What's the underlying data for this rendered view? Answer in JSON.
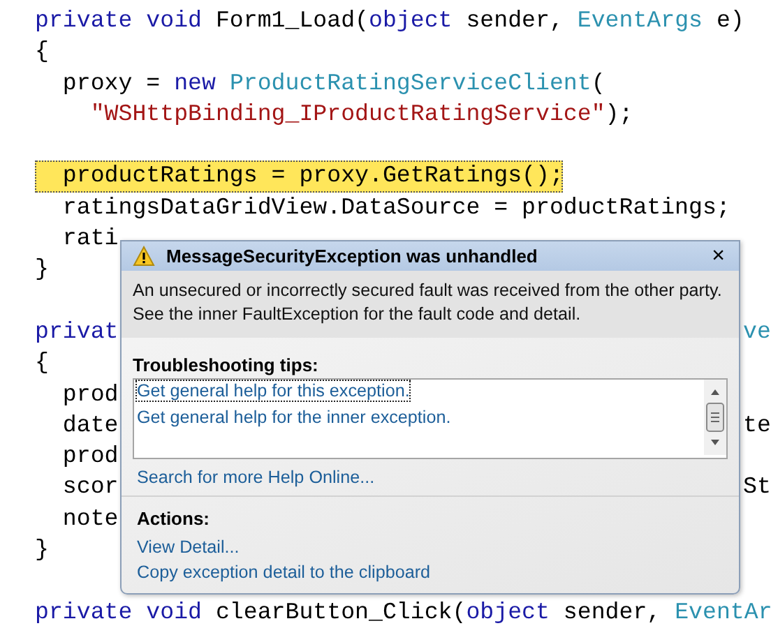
{
  "code_lines": [
    {
      "highlighted": false,
      "tokens": [
        {
          "kind": "kw",
          "text": "private void "
        },
        {
          "kind": "plain",
          "text": "Form1_Load("
        },
        {
          "kind": "kw",
          "text": "object"
        },
        {
          "kind": "plain",
          "text": " sender, "
        },
        {
          "kind": "type",
          "text": "EventArgs"
        },
        {
          "kind": "plain",
          "text": " e)"
        }
      ]
    },
    {
      "highlighted": false,
      "tokens": [
        {
          "kind": "plain",
          "text": "{"
        }
      ]
    },
    {
      "highlighted": false,
      "tokens": [
        {
          "kind": "plain",
          "text": "  proxy = "
        },
        {
          "kind": "kw",
          "text": "new "
        },
        {
          "kind": "type",
          "text": "ProductRatingServiceClient"
        },
        {
          "kind": "plain",
          "text": "("
        }
      ]
    },
    {
      "highlighted": false,
      "tokens": [
        {
          "kind": "str",
          "text": "    \"WSHttpBinding_IProductRatingService\""
        },
        {
          "kind": "plain",
          "text": ");"
        }
      ]
    },
    {
      "kind": "blank"
    },
    {
      "highlighted": true,
      "tokens": [
        {
          "kind": "plain",
          "text": "  productRatings = proxy.GetRatings();"
        }
      ]
    },
    {
      "highlighted": false,
      "tokens": [
        {
          "kind": "plain",
          "text": "  ratingsDataGridView.DataSource = productRatings;"
        }
      ]
    },
    {
      "highlighted": false,
      "tokens": [
        {
          "kind": "plain",
          "text": "  rati"
        }
      ]
    },
    {
      "highlighted": false,
      "tokens": [
        {
          "kind": "plain",
          "text": "}"
        }
      ]
    },
    {
      "kind": "blank"
    },
    {
      "highlighted": false,
      "tokens": [
        {
          "kind": "kw",
          "text": "privat"
        }
      ],
      "right": {
        "kind": "type",
        "text": "ve"
      }
    },
    {
      "highlighted": false,
      "tokens": [
        {
          "kind": "plain",
          "text": "{"
        }
      ]
    },
    {
      "highlighted": false,
      "tokens": [
        {
          "kind": "plain",
          "text": "  prod"
        }
      ]
    },
    {
      "highlighted": false,
      "tokens": [
        {
          "kind": "plain",
          "text": "  date"
        }
      ],
      "right": {
        "kind": "plain",
        "text": "te"
      }
    },
    {
      "highlighted": false,
      "tokens": [
        {
          "kind": "plain",
          "text": "  prod"
        }
      ]
    },
    {
      "highlighted": false,
      "tokens": [
        {
          "kind": "plain",
          "text": "  scor"
        }
      ],
      "right": {
        "kind": "plain",
        "text": "St"
      }
    },
    {
      "highlighted": false,
      "tokens": [
        {
          "kind": "plain",
          "text": "  note"
        }
      ]
    },
    {
      "highlighted": false,
      "tokens": [
        {
          "kind": "plain",
          "text": "}"
        }
      ]
    },
    {
      "kind": "blank"
    },
    {
      "highlighted": false,
      "tokens": [
        {
          "kind": "kw",
          "text": "private void "
        },
        {
          "kind": "plain",
          "text": "clearButton_Click("
        },
        {
          "kind": "kw",
          "text": "object"
        },
        {
          "kind": "plain",
          "text": " sender, "
        },
        {
          "kind": "type",
          "text": "EventAr"
        }
      ]
    }
  ],
  "exception_popup": {
    "title": "MessageSecurityException was unhandled",
    "close": "×",
    "message": "An unsecured or incorrectly secured fault was received from the other party. See the inner FaultException for the fault code and detail.",
    "tips_heading": "Troubleshooting tips:",
    "tips": [
      {
        "text": "Get general help for this exception.",
        "selected": true
      },
      {
        "text": "Get general help for the inner exception.",
        "selected": false
      }
    ],
    "search_link": "Search for more Help Online...",
    "actions_heading": "Actions:",
    "actions": [
      "View Detail...",
      "Copy exception detail to the clipboard"
    ]
  }
}
